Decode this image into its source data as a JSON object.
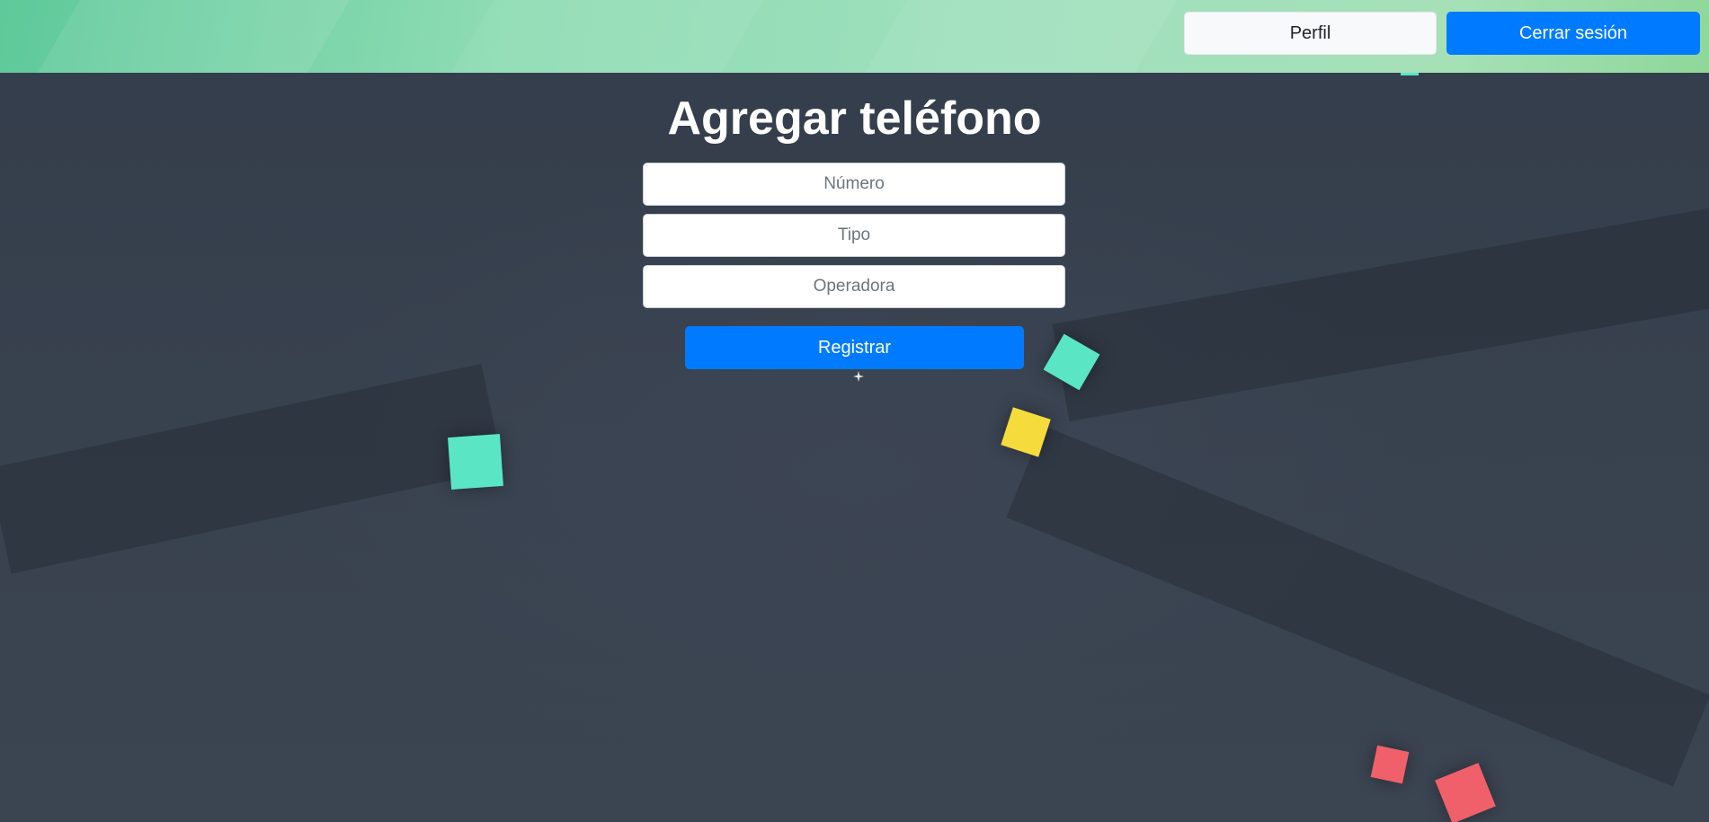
{
  "header": {
    "profile_label": "Perfil",
    "logout_label": "Cerrar sesión"
  },
  "main": {
    "title": "Agregar teléfono",
    "fields": [
      {
        "placeholder": "Número",
        "value": ""
      },
      {
        "placeholder": "Tipo",
        "value": ""
      },
      {
        "placeholder": "Operadora",
        "value": ""
      }
    ],
    "submit_label": "Registrar"
  },
  "colors": {
    "header_gradient_start": "#5ec99a",
    "header_gradient_end": "#a6e0b7",
    "primary": "#007bff",
    "background": "#353e4c",
    "shape_teal": "#5ae6c4",
    "shape_yellow": "#f5dc3c",
    "shape_red": "#f0606a"
  }
}
